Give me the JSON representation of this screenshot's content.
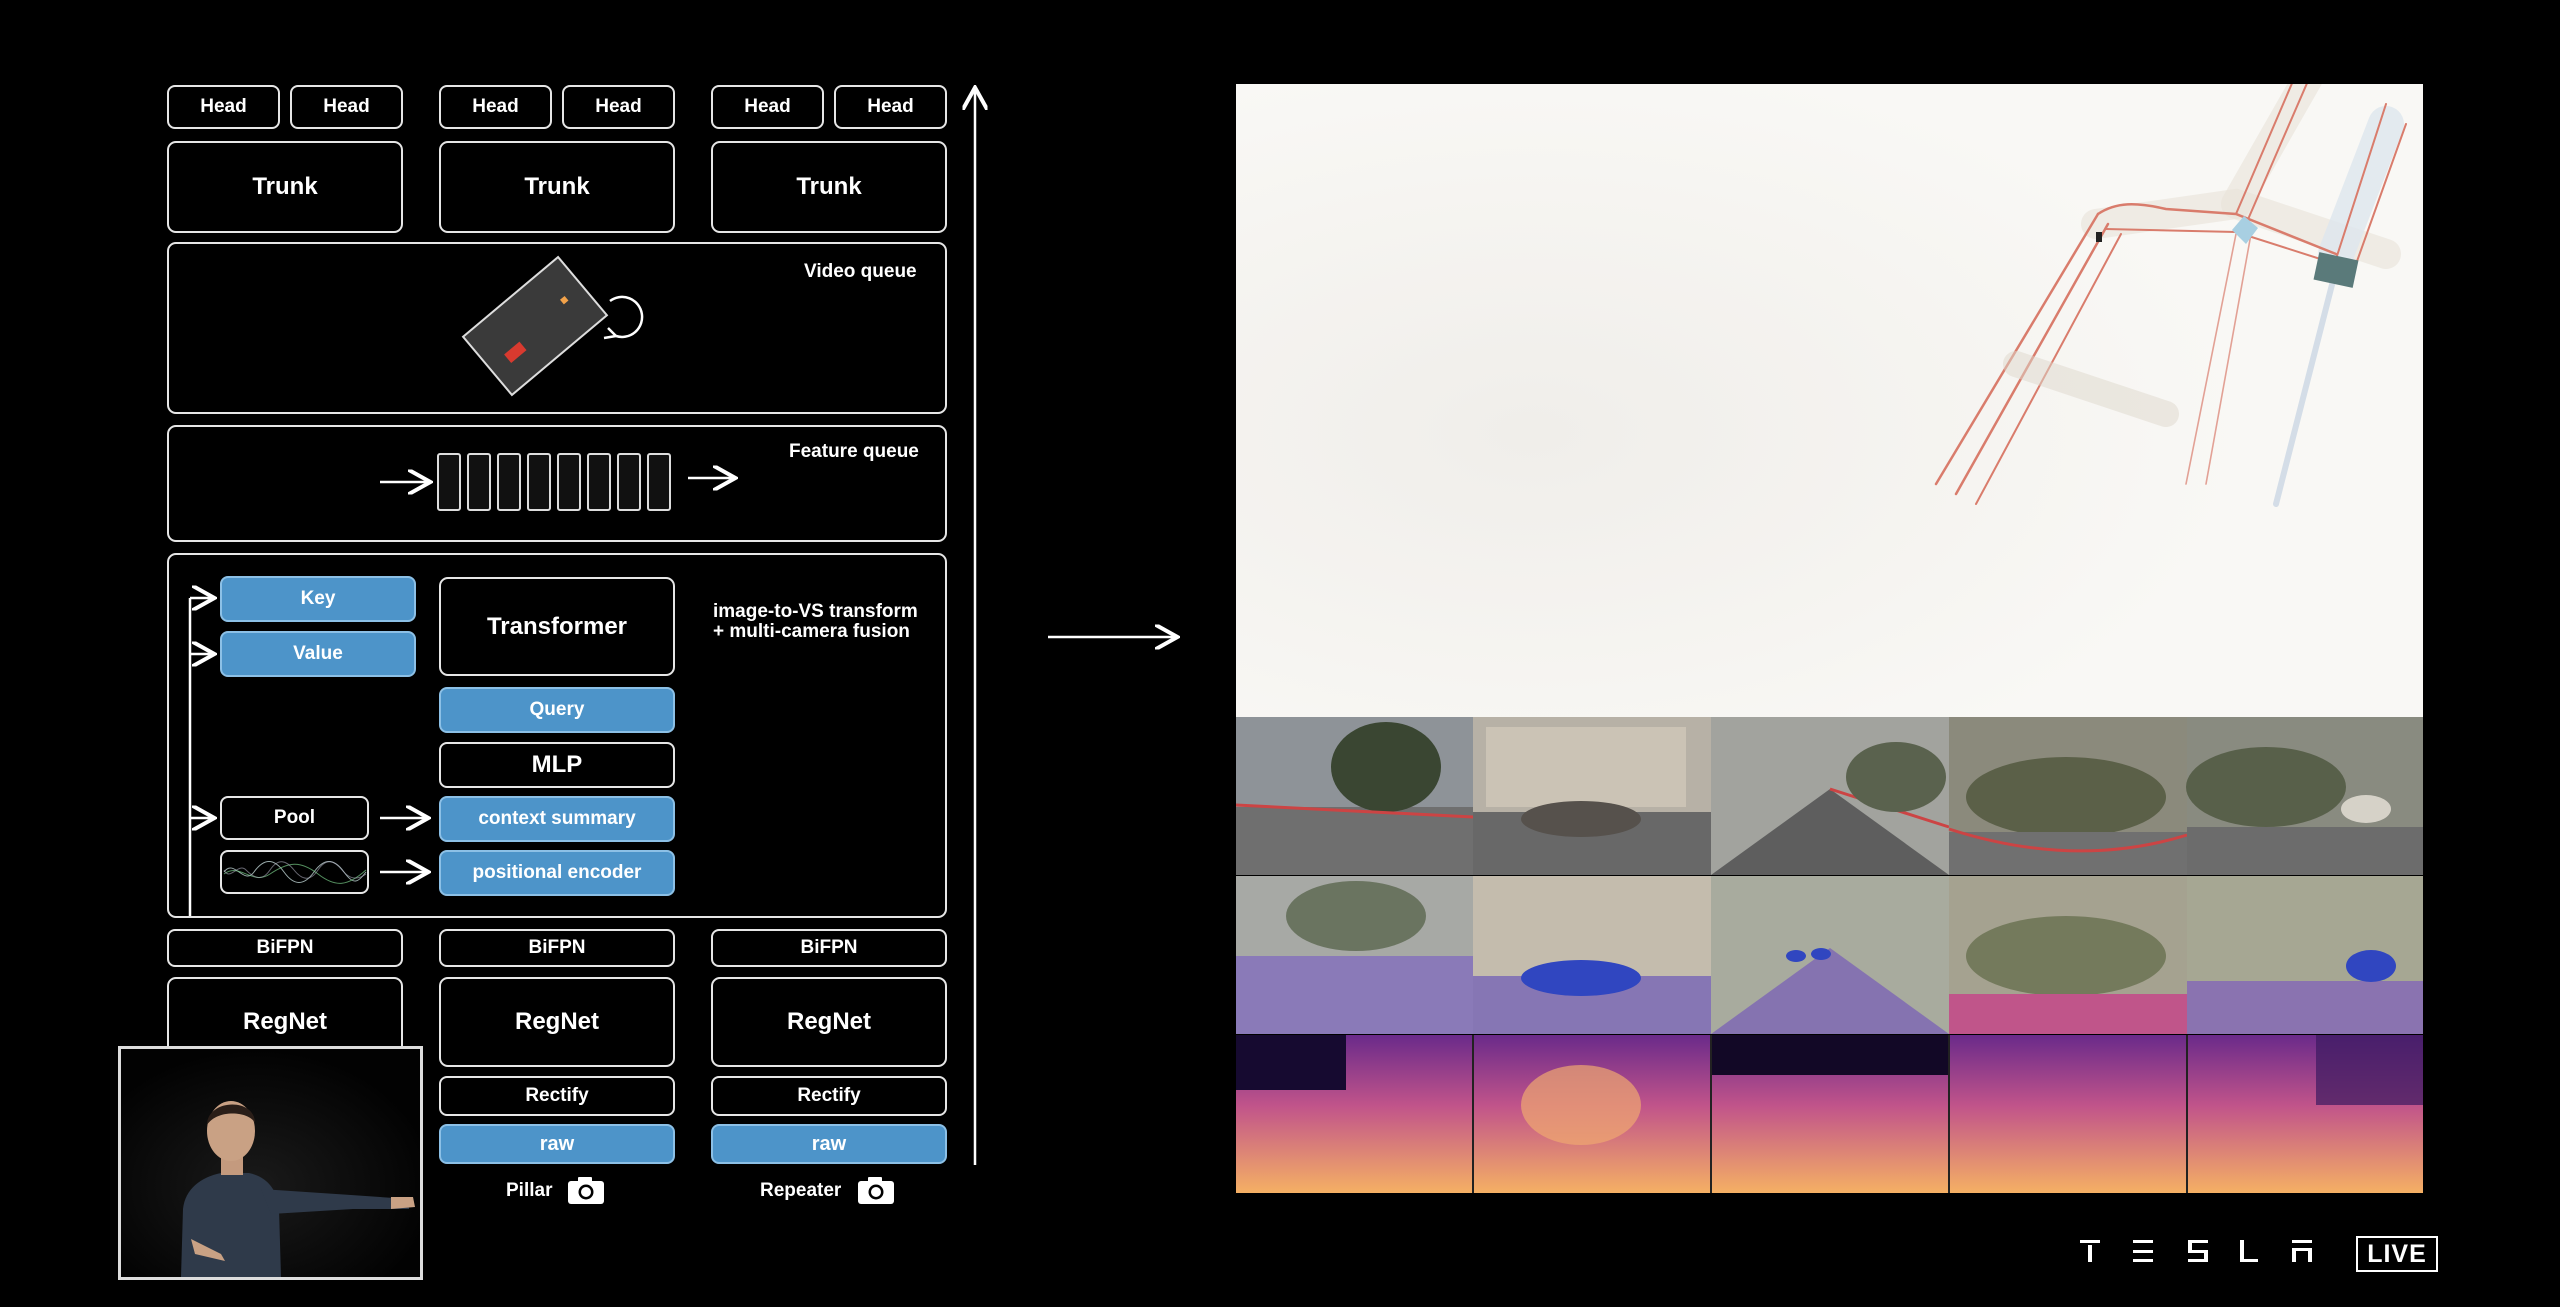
{
  "diagram": {
    "heads": [
      "Head",
      "Head",
      "Head",
      "Head",
      "Head",
      "Head"
    ],
    "trunks": [
      "Trunk",
      "Trunk",
      "Trunk"
    ],
    "video_queue": "Video queue",
    "feature_queue": "Feature queue",
    "transformer_block": {
      "key": "Key",
      "value": "Value",
      "transformer": "Transformer",
      "description_line1": "image-to-VS transform",
      "description_line2": "+ multi-camera fusion",
      "query": "Query",
      "mlp": "MLP",
      "pool": "Pool",
      "context_summary": "context summary",
      "positional_encoder": "positional encoder"
    },
    "bifpn": [
      "BiFPN",
      "BiFPN",
      "BiFPN"
    ],
    "regnet": [
      "RegNet",
      "RegNet",
      "RegNet"
    ],
    "rectify": [
      "Rectify",
      "Rectify"
    ],
    "raw": [
      "raw",
      "raw"
    ],
    "cameras": [
      "Pillar",
      "Repeater"
    ]
  },
  "colors": {
    "accent_blue": "#4d94c9",
    "box_border": "#e6e6e6",
    "background": "#000000"
  },
  "branding": {
    "logo_text": "TESLA",
    "live_badge": "LIVE"
  }
}
